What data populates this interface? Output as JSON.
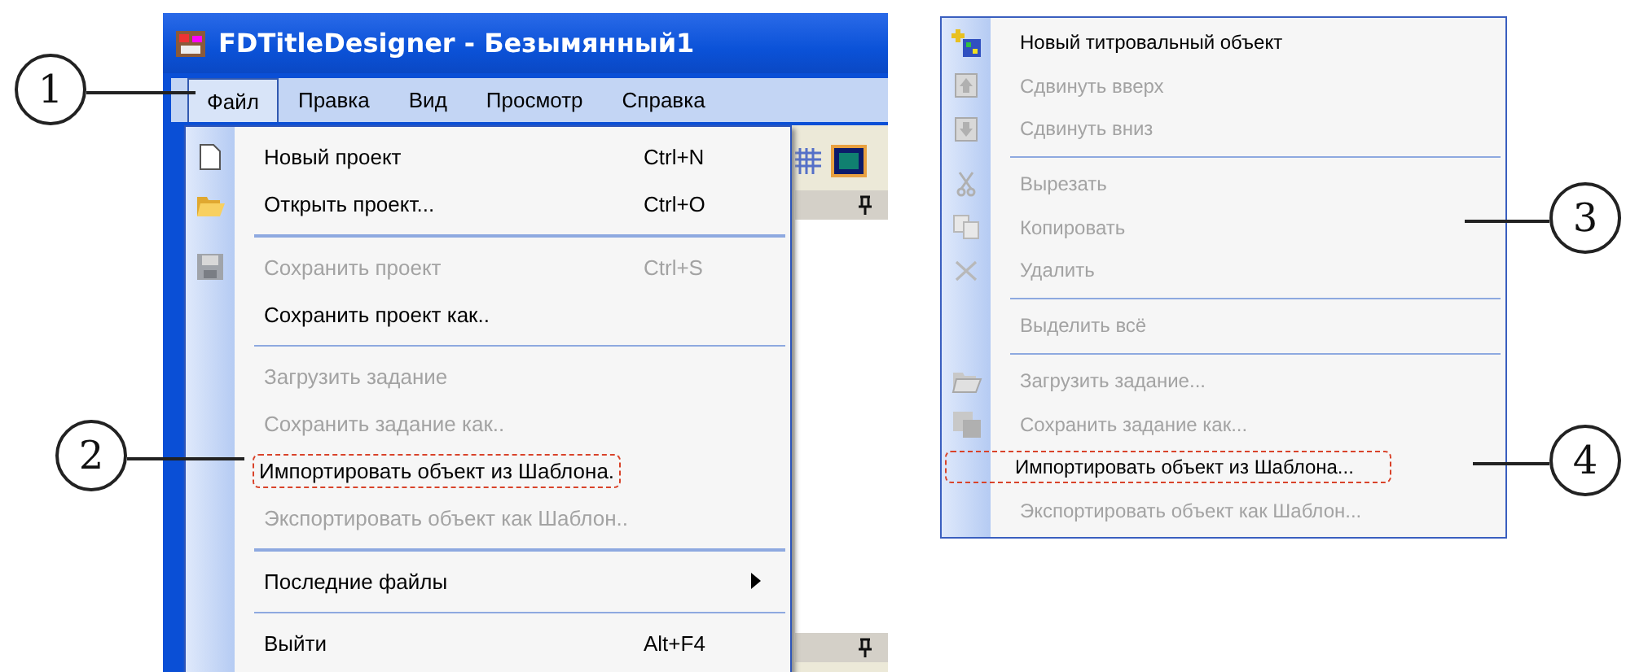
{
  "screenshot_1": {
    "window_title": "FDTitleDesigner - Безымянный1",
    "menu_bar": [
      {
        "label": "Файл",
        "selected": true
      },
      {
        "label": "Правка",
        "selected": false
      },
      {
        "label": "Вид",
        "selected": false
      },
      {
        "label": "Просмотр",
        "selected": false
      },
      {
        "label": "Справка",
        "selected": false
      }
    ],
    "file_menu": [
      {
        "kind": "item",
        "label": "Новый проект",
        "shortcut": "Ctrl+N",
        "disabled": false,
        "highlighted": false
      },
      {
        "kind": "item",
        "label": "Открыть проект...",
        "shortcut": "Ctrl+O",
        "disabled": false,
        "highlighted": false
      },
      {
        "kind": "separator"
      },
      {
        "kind": "item",
        "label": "Сохранить проект",
        "shortcut": "Ctrl+S",
        "disabled": true,
        "highlighted": false
      },
      {
        "kind": "item",
        "label": "Сохранить проект как..",
        "disabled": false,
        "highlighted": false
      },
      {
        "kind": "separator"
      },
      {
        "kind": "item",
        "label": "Загрузить задание",
        "disabled": true,
        "highlighted": false
      },
      {
        "kind": "item",
        "label": "Сохранить задание как..",
        "disabled": true,
        "highlighted": false
      },
      {
        "kind": "item",
        "label": "Импортировать объект из Шаблона.",
        "disabled": false,
        "highlighted": true
      },
      {
        "kind": "item",
        "label": "Экспортировать объект как Шаблон..",
        "disabled": true,
        "highlighted": false
      },
      {
        "kind": "separator"
      },
      {
        "kind": "submenu",
        "label": "Последние файлы",
        "disabled": false,
        "highlighted": false
      },
      {
        "kind": "separator"
      },
      {
        "kind": "item",
        "label": "Выйти",
        "shortcut": "Alt+F4",
        "disabled": false,
        "highlighted": false
      }
    ]
  },
  "screenshot_2": {
    "context_menu": [
      {
        "kind": "item",
        "label": "Новый титровальный объект",
        "disabled": false,
        "highlighted": false
      },
      {
        "kind": "item",
        "label": "Сдвинуть вверх",
        "disabled": true,
        "highlighted": false
      },
      {
        "kind": "item",
        "label": "Сдвинуть вниз",
        "disabled": true,
        "highlighted": false
      },
      {
        "kind": "separator"
      },
      {
        "kind": "item",
        "label": "Вырезать",
        "disabled": true,
        "highlighted": false
      },
      {
        "kind": "item",
        "label": "Копировать",
        "disabled": true,
        "highlighted": false
      },
      {
        "kind": "item",
        "label": "Удалить",
        "disabled": true,
        "highlighted": false
      },
      {
        "kind": "separator"
      },
      {
        "kind": "item",
        "label": "Выделить всё",
        "disabled": true,
        "highlighted": false
      },
      {
        "kind": "separator"
      },
      {
        "kind": "item",
        "label": "Загрузить задание...",
        "disabled": true,
        "highlighted": false
      },
      {
        "kind": "item",
        "label": "Сохранить задание как...",
        "disabled": true,
        "highlighted": false
      },
      {
        "kind": "item",
        "label": "Импортировать объект из Шаблона...",
        "disabled": false,
        "highlighted": true
      },
      {
        "kind": "item",
        "label": "Экспортировать объект как  Шаблон...",
        "disabled": true,
        "highlighted": false
      }
    ]
  },
  "callouts": [
    {
      "number": "1"
    },
    {
      "number": "2"
    },
    {
      "number": "3"
    },
    {
      "number": "4"
    }
  ]
}
